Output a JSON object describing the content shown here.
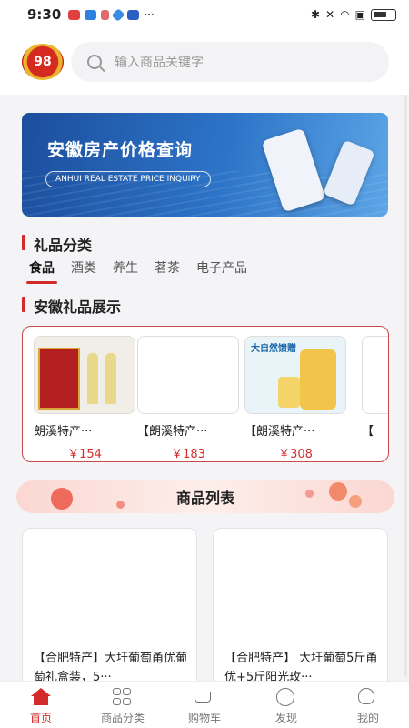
{
  "status_bar": {
    "time": "9:30",
    "more": "···"
  },
  "header": {
    "logo_text": "98",
    "search_placeholder": "输入商品关键字"
  },
  "banner": {
    "title": "安徽房产价格查询",
    "subtitle": "ANHUI REAL ESTATE PRICE INQUIRY"
  },
  "categories": {
    "title": "礼品分类",
    "tabs": [
      {
        "label": "食品",
        "active": true
      },
      {
        "label": "酒类"
      },
      {
        "label": "养生"
      },
      {
        "label": "茗茶"
      },
      {
        "label": "电子产品"
      }
    ]
  },
  "showcase": {
    "title": "安徽礼品展示",
    "items": [
      {
        "name": "朗溪特产···",
        "price": "￥154"
      },
      {
        "name": "【朗溪特产···",
        "price": "￥183"
      },
      {
        "name": "【朗溪特产···",
        "price": "￥308"
      },
      {
        "name": "【",
        "price": ""
      }
    ],
    "oil_label": "大自然馈赠"
  },
  "product_list": {
    "title": "商品列表",
    "items": [
      {
        "name": "【合肥特产】大圩葡萄甬优葡萄礼盒装，5···"
      },
      {
        "name": "【合肥特产】 大圩葡萄5斤甬优+5斤阳光玫···"
      }
    ]
  },
  "tabbar": {
    "items": [
      {
        "label": "首页",
        "active": true
      },
      {
        "label": "商品分类"
      },
      {
        "label": "购物车"
      },
      {
        "label": "发现"
      },
      {
        "label": "我的"
      }
    ]
  },
  "colors": {
    "accent": "#d32b2b",
    "banner_blue": "#1c4e9d"
  }
}
